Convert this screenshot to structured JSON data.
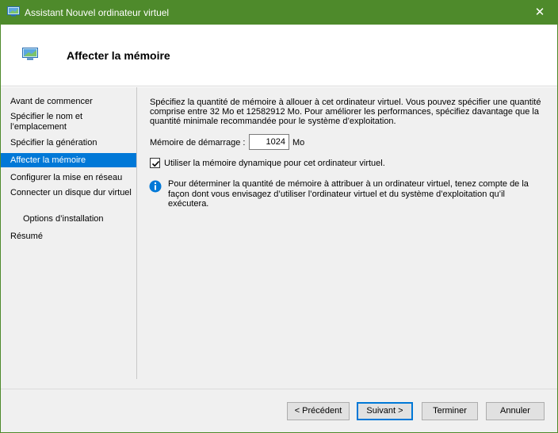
{
  "window": {
    "title": "Assistant Nouvel ordinateur virtuel",
    "close_glyph": "✕",
    "icon": "vm-monitor-icon"
  },
  "header": {
    "title": "Affecter la mémoire",
    "icon": "vm-monitor-icon"
  },
  "nav": {
    "items": [
      {
        "label": "Avant de commencer"
      },
      {
        "label": "Spécifier le nom et l’emplacement"
      },
      {
        "label": "Spécifier la génération"
      },
      {
        "label": "Affecter la mémoire",
        "active": true
      },
      {
        "label": "Configurer la mise en réseau"
      },
      {
        "label": "Connecter un disque dur virtuel"
      },
      {
        "label": "Options d’installation"
      },
      {
        "label": "Résumé"
      }
    ]
  },
  "main": {
    "description": "Spécifiez la quantité de mémoire à allouer à cet ordinateur virtuel. Vous pouvez spécifier une quantité comprise entre 32 Mo et 12582912 Mo. Pour améliorer les performances, spécifiez davantage que la quantité minimale recommandée pour le système d’exploitation.",
    "startup_memory_label": "Mémoire de démarrage :",
    "startup_memory_value": "1024",
    "startup_memory_unit": "Mo",
    "dynamic_memory_label": "Utiliser la mémoire dynamique pour cet ordinateur virtuel.",
    "dynamic_memory_checked": true,
    "info_text": "Pour déterminer la quantité de mémoire à attribuer à un ordinateur virtuel, tenez compte de la façon dont vous envisagez d’utiliser l’ordinateur virtuel et du système d’exploitation qu’il exécutera.",
    "info_icon": "info-icon"
  },
  "footer": {
    "previous": "< Précédent",
    "next": "Suivant >",
    "finish": "Terminer",
    "cancel": "Annuler"
  },
  "colors": {
    "titlebar": "#4e8a2b",
    "selection": "#0078d7",
    "info": "#0078d7"
  }
}
